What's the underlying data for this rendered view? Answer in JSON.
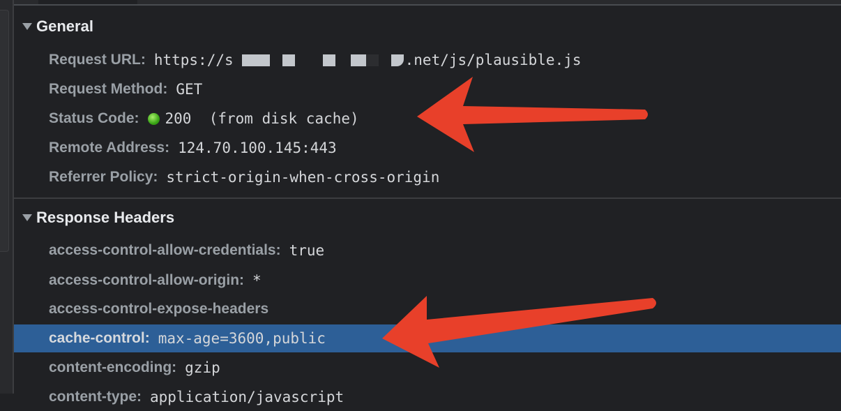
{
  "general": {
    "title": "General",
    "rows": [
      {
        "key": "Request URL:",
        "value_prefix": "https://s",
        "value_suffix": ".net/js/plausible.js"
      },
      {
        "key": "Request Method:",
        "value": "GET"
      },
      {
        "key": "Status Code:",
        "value": "200  (from disk cache)",
        "status_color": "#3aa516"
      },
      {
        "key": "Remote Address:",
        "value": "124.70.100.145:443"
      },
      {
        "key": "Referrer Policy:",
        "value": "strict-origin-when-cross-origin"
      }
    ]
  },
  "response_headers": {
    "title": "Response Headers",
    "rows": [
      {
        "key": "access-control-allow-credentials:",
        "value": "true"
      },
      {
        "key": "access-control-allow-origin:",
        "value": "*"
      },
      {
        "key": "access-control-expose-headers",
        "value": ""
      },
      {
        "key": "cache-control:",
        "value": "max-age=3600,public",
        "selected": true
      },
      {
        "key": "content-encoding:",
        "value": "gzip"
      },
      {
        "key": "content-type:",
        "value": "application/javascript"
      }
    ]
  },
  "colors": {
    "highlight": "#2d5f97",
    "annotation_arrow": "#e8402a"
  }
}
